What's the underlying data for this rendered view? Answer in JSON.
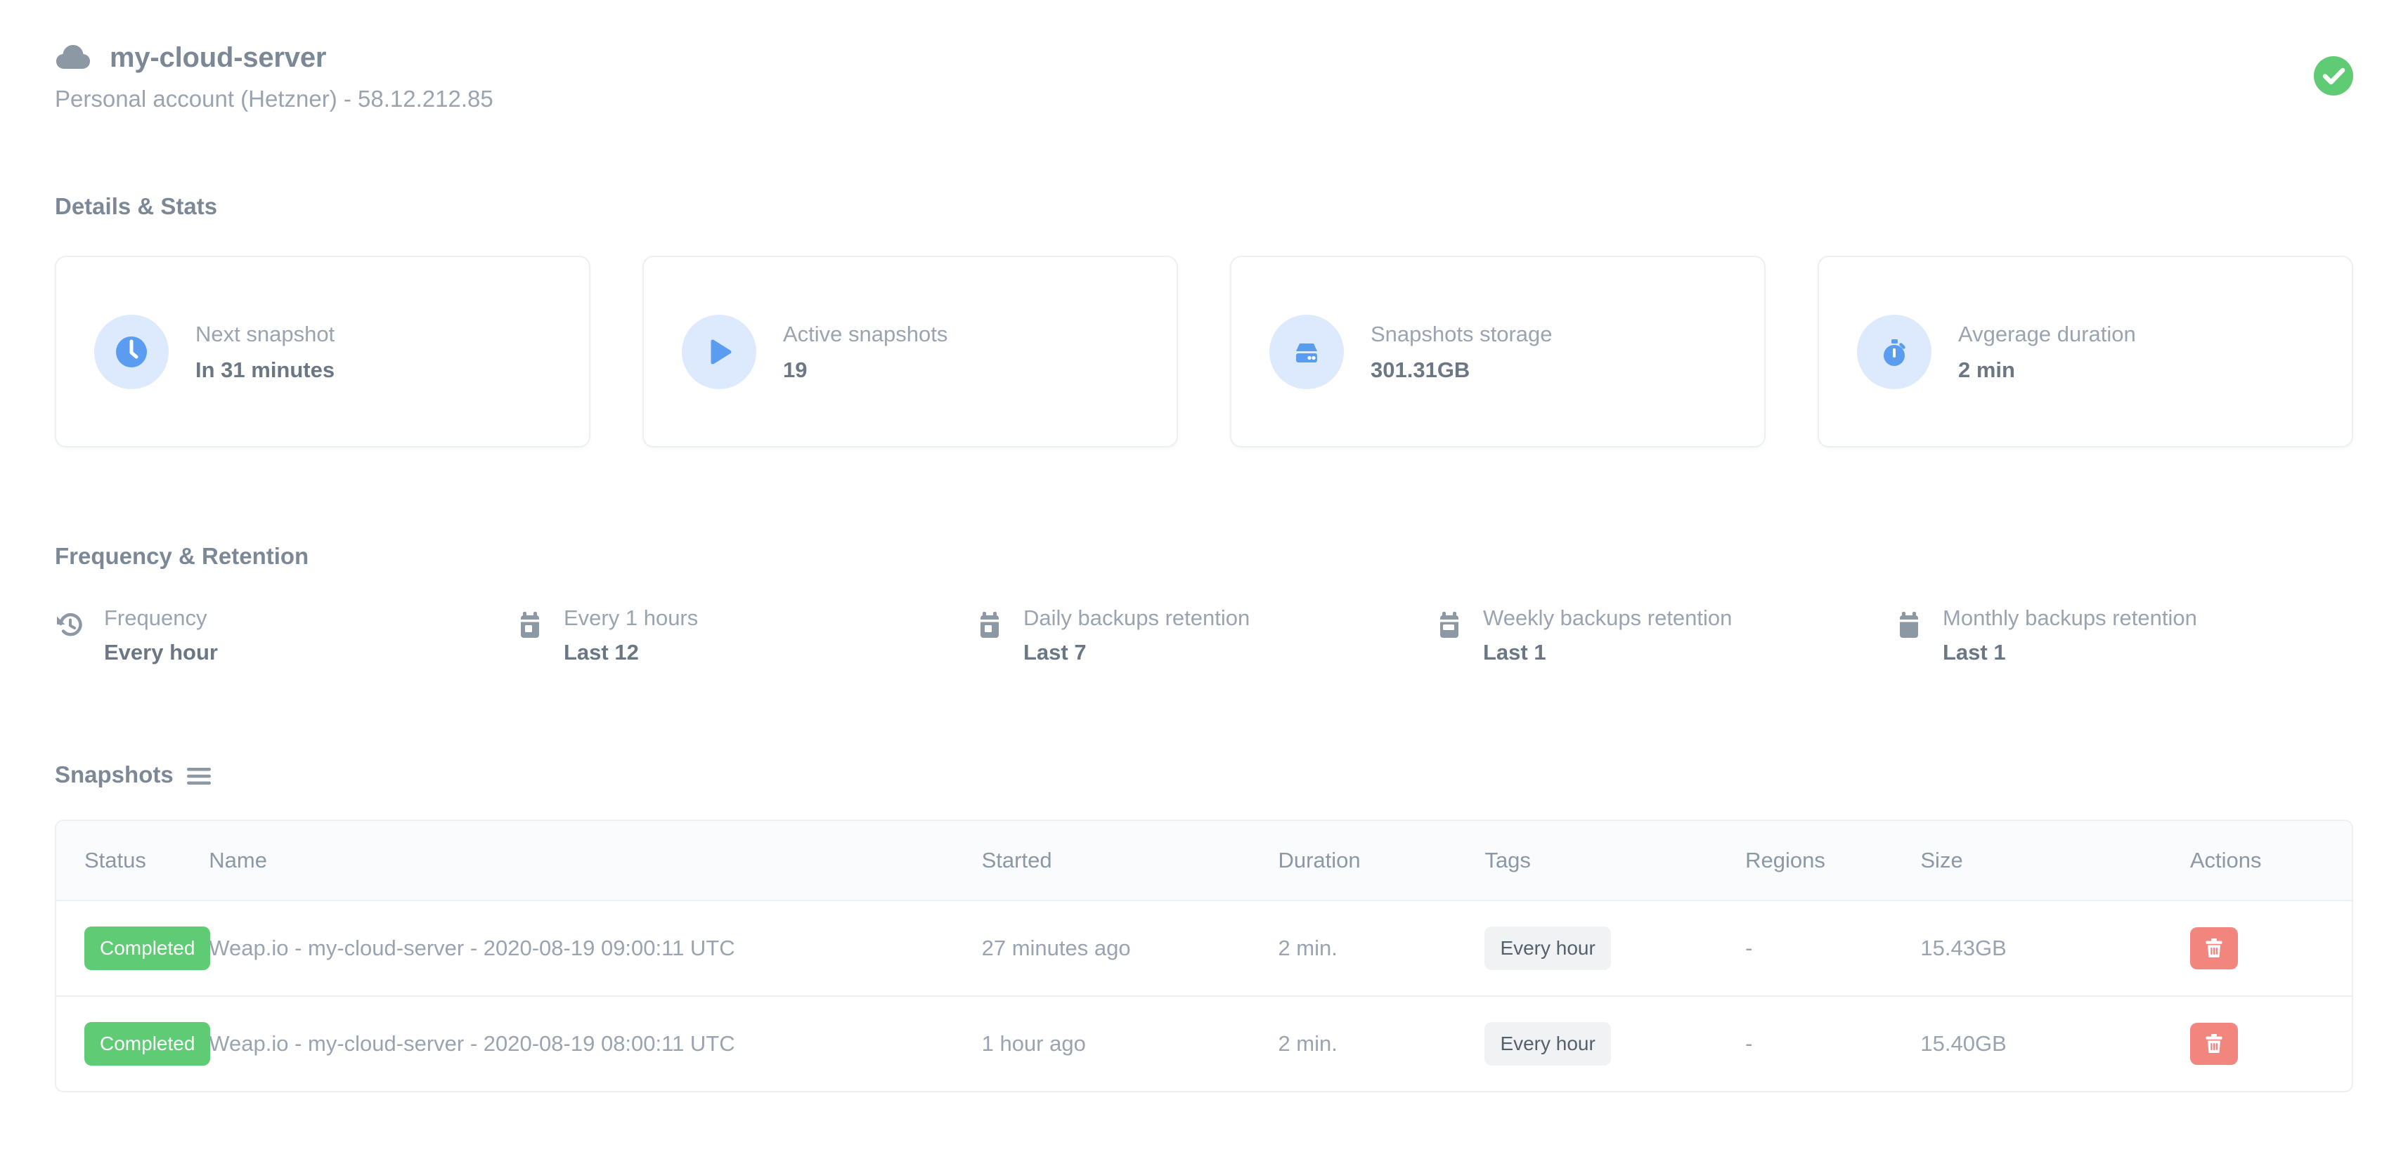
{
  "header": {
    "cloud_icon": "cloud-icon",
    "server_name": "my-cloud-server",
    "account_line": "Personal account (Hetzner) - 58.12.212.85",
    "status_icon": "check-circle-icon",
    "status_color": "#5fcb74"
  },
  "details_stats": {
    "title": "Details & Stats",
    "cards": [
      {
        "icon": "clock-icon",
        "label": "Next snapshot",
        "value": "In 31 minutes"
      },
      {
        "icon": "play-icon",
        "label": "Active snapshots",
        "value": "19"
      },
      {
        "icon": "hard-drive-icon",
        "label": "Snapshots storage",
        "value": "301.31GB"
      },
      {
        "icon": "stopwatch-icon",
        "label": "Avgerage duration",
        "value": "2 min"
      }
    ],
    "icon_bg_color": "#ddeafd",
    "icon_color": "#5a9cf0"
  },
  "frequency_retention": {
    "title": "Frequency & Retention",
    "items": [
      {
        "icon": "history-icon",
        "label": "Frequency",
        "value": "Every hour"
      },
      {
        "icon": "calendar-icon",
        "label": "Every 1 hours",
        "value": "Last 12"
      },
      {
        "icon": "calendar-icon",
        "label": "Daily backups retention",
        "value": "Last 7"
      },
      {
        "icon": "calendar-icon",
        "label": "Weekly backups retention",
        "value": "Last 1"
      },
      {
        "icon": "calendar-icon",
        "label": "Monthly backups retention",
        "value": "Last 1"
      }
    ]
  },
  "snapshots": {
    "title": "Snapshots",
    "menu_icon": "hamburger-icon",
    "columns": [
      "Status",
      "Name",
      "Started",
      "Duration",
      "Tags",
      "Regions",
      "Size",
      "Actions"
    ],
    "rows": [
      {
        "status": "Completed",
        "name": "Weap.io - my-cloud-server - 2020-08-19 09:00:11 UTC",
        "started": "27 minutes ago",
        "duration": "2 min.",
        "tag": "Every hour",
        "regions": "-",
        "size": "15.43GB",
        "action_icon": "trash-icon"
      },
      {
        "status": "Completed",
        "name": "Weap.io - my-cloud-server - 2020-08-19 08:00:11 UTC",
        "started": "1 hour ago",
        "duration": "2 min.",
        "tag": "Every hour",
        "regions": "-",
        "size": "15.40GB",
        "action_icon": "trash-icon"
      }
    ],
    "badge_color": "#5fcb74",
    "delete_color": "#f2867f"
  }
}
